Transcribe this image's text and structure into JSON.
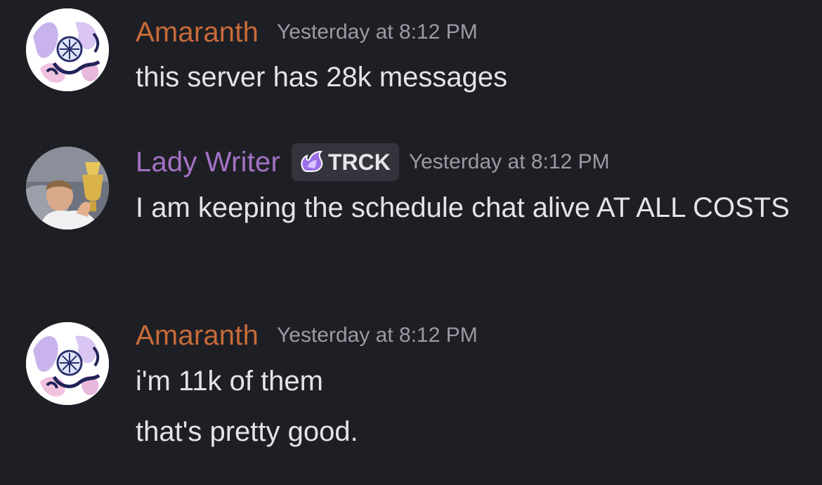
{
  "colors": {
    "background": "#1e1f24",
    "amaranth_name": "#c86b3a",
    "lady_writer_name": "#a472c6",
    "timestamp": "#9a9ba4",
    "message_text": "#e3e4e8",
    "tag_bg": "#34353c"
  },
  "messages": [
    {
      "author": "Amaranth",
      "avatar_icon": "pokemon-avatar-icon",
      "timestamp": "Yesterday at 8:12 PM",
      "lines": [
        "this server has 28k messages"
      ]
    },
    {
      "author": "Lady Writer",
      "avatar_icon": "photo-avatar-icon",
      "tag_icon": "purple-flame-icon",
      "tag": "TRCK",
      "timestamp": "Yesterday at 8:12 PM",
      "lines": [
        "I am keeping the schedule chat alive AT ALL COSTS"
      ]
    },
    {
      "author": "Amaranth",
      "avatar_icon": "pokemon-avatar-icon",
      "timestamp": "Yesterday at 8:12 PM",
      "lines": [
        "i'm 11k of them",
        "that's pretty good."
      ]
    }
  ]
}
